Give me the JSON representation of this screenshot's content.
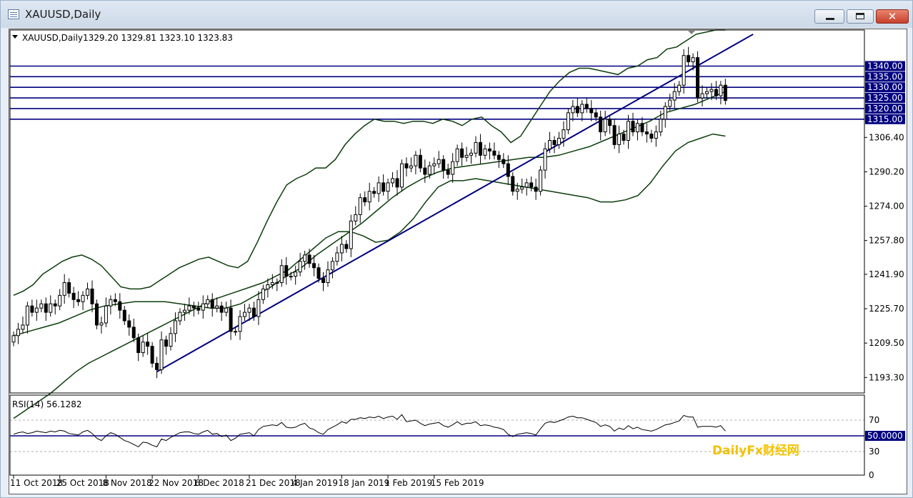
{
  "window": {
    "title": "XAUUSD,Daily",
    "close_glyph": "✕"
  },
  "watermark": "DailyFx财经网",
  "colors": {
    "candle": "#000000",
    "band": "#0b3d0b",
    "level": "#000080",
    "trend": "#000080",
    "rsi": "#000000",
    "price_tag_bg": "#000080"
  },
  "chart_data": {
    "type": "candlestick",
    "symbol_header": "XAUUSD,Daily",
    "ohlc_header": "1329.20 1329.81 1323.10 1323.83",
    "ylim": [
      1186,
      1357
    ],
    "y_ticks": [
      "1306.40",
      "1290.20",
      "1274.00",
      "1257.80",
      "1241.90",
      "1225.70",
      "1209.50",
      "1193.30"
    ],
    "y_tick_values": [
      1306.4,
      1290.2,
      1274.0,
      1257.8,
      1241.9,
      1225.7,
      1209.5,
      1193.3
    ],
    "x_ticks": [
      "11 Oct 2018",
      "25 Oct 2018",
      "8 Nov 2018",
      "22 Nov 2018",
      "6 Dec 2018",
      "21 Dec 2018",
      "4 Jan 2019",
      "18 Jan 2019",
      "1 Feb 2019",
      "15 Feb 2019"
    ],
    "x_tick_index": [
      0,
      10,
      20,
      30,
      40,
      51,
      61,
      71,
      81,
      91
    ],
    "close": [
      1213,
      1216,
      1218,
      1227,
      1224,
      1226,
      1228,
      1224,
      1228,
      1227,
      1232,
      1238,
      1233,
      1230,
      1229,
      1232,
      1235,
      1228,
      1218,
      1219,
      1227,
      1230,
      1229,
      1225,
      1220,
      1217,
      1212,
      1205,
      1210,
      1208,
      1200,
      1197,
      1211,
      1208,
      1214,
      1220,
      1224,
      1225,
      1227,
      1226,
      1225,
      1228,
      1230,
      1226,
      1227,
      1224,
      1226,
      1215,
      1215,
      1222,
      1224,
      1226,
      1222,
      1230,
      1235,
      1237,
      1238,
      1238,
      1246,
      1241,
      1241,
      1243,
      1248,
      1251,
      1247,
      1245,
      1240,
      1238,
      1244,
      1248,
      1252,
      1256,
      1254,
      1267,
      1270,
      1278,
      1276,
      1281,
      1280,
      1285,
      1281,
      1285,
      1287,
      1283,
      1294,
      1292,
      1293,
      1298,
      1292,
      1289,
      1293,
      1294,
      1296,
      1291,
      1289,
      1295,
      1301,
      1297,
      1298,
      1299,
      1304,
      1298,
      1301,
      1300,
      1298,
      1296,
      1294,
      1288,
      1281,
      1282,
      1283,
      1285,
      1283,
      1281,
      1291,
      1301,
      1305,
      1303,
      1306,
      1310,
      1318,
      1321,
      1318,
      1322,
      1320,
      1318,
      1316,
      1309,
      1315,
      1312,
      1303,
      1308,
      1305,
      1314,
      1309,
      1313,
      1309,
      1308,
      1306,
      1309,
      1315,
      1321,
      1324,
      1328,
      1331,
      1345,
      1342,
      1344,
      1325,
      1327,
      1328,
      1329,
      1326,
      1331,
      1323.83
    ],
    "bb_upper": [
      1232,
      1234,
      1237,
      1242,
      1245,
      1248,
      1250,
      1251,
      1249,
      1246,
      1241,
      1236,
      1235,
      1235,
      1236,
      1239,
      1242,
      1245,
      1247,
      1249,
      1250,
      1248,
      1246,
      1245,
      1248,
      1257,
      1267,
      1276,
      1284,
      1287,
      1289,
      1292,
      1292,
      1296,
      1303,
      1308,
      1312,
      1315,
      1314,
      1314,
      1313,
      1314,
      1314,
      1313,
      1315,
      1314,
      1312,
      1315,
      1316,
      1312,
      1309,
      1304,
      1307,
      1314,
      1321,
      1328,
      1333,
      1337,
      1339,
      1339,
      1338,
      1337,
      1336,
      1339,
      1340,
      1343,
      1344,
      1348,
      1349,
      1352,
      1355,
      1356,
      1357,
      1357
    ],
    "bb_mid": [
      1213,
      1215,
      1217,
      1219,
      1222,
      1225,
      1227,
      1228,
      1229,
      1229,
      1229,
      1228,
      1227,
      1226,
      1226,
      1228,
      1232,
      1236,
      1241,
      1245,
      1251,
      1256,
      1261,
      1266,
      1272,
      1278,
      1283,
      1287,
      1290,
      1292,
      1293,
      1294,
      1295,
      1296,
      1297,
      1297,
      1298,
      1300,
      1302,
      1305,
      1308,
      1311,
      1314,
      1318,
      1320,
      1322,
      1325,
      1328
    ],
    "bb_lower": [
      1174,
      1178,
      1182,
      1186,
      1191,
      1196,
      1200,
      1203,
      1206,
      1209,
      1212,
      1215,
      1218,
      1221,
      1224,
      1227,
      1230,
      1232,
      1234,
      1236,
      1238,
      1241,
      1244,
      1249,
      1254,
      1259,
      1262,
      1262,
      1260,
      1257,
      1258,
      1262,
      1268,
      1276,
      1283,
      1286,
      1286,
      1287,
      1286,
      1285,
      1284,
      1283,
      1282,
      1281,
      1280,
      1279,
      1278,
      1276,
      1276,
      1277,
      1279,
      1285,
      1293,
      1300,
      1304,
      1306,
      1308,
      1307
    ],
    "levels": [
      1340.0,
      1335.0,
      1330.0,
      1325.0,
      1320.0,
      1315.0
    ],
    "level_labels": [
      "1340.00",
      "1335.00",
      "1330.00",
      "1325.00",
      "1320.00",
      "1315.00"
    ],
    "trendline": {
      "start_index": 31,
      "start_price": 1196,
      "end_index": 160,
      "end_price": 1355
    },
    "rsi": {
      "label": "RSI(14) 56.1282",
      "levels": [
        70,
        50,
        30
      ],
      "level_labels": [
        "70",
        "30",
        "0"
      ],
      "highlight_level_label": "50.0000",
      "values": [
        52,
        54,
        55,
        53,
        54,
        56,
        55,
        54,
        56,
        55,
        57,
        56,
        53,
        52,
        51,
        55,
        57,
        53,
        47,
        44,
        50,
        54,
        52,
        48,
        44,
        42,
        39,
        36,
        42,
        41,
        38,
        36,
        46,
        44,
        48,
        51,
        54,
        55,
        55,
        53,
        52,
        55,
        57,
        52,
        53,
        49,
        51,
        44,
        47,
        52,
        53,
        54,
        50,
        58,
        62,
        63,
        64,
        63,
        67,
        61,
        60,
        61,
        64,
        66,
        60,
        58,
        54,
        52,
        58,
        61,
        64,
        68,
        66,
        71,
        71,
        73,
        72,
        74,
        73,
        75,
        72,
        74,
        75,
        71,
        77,
        68,
        69,
        70,
        66,
        63,
        65,
        66,
        67,
        63,
        61,
        64,
        68,
        64,
        66,
        66,
        68,
        63,
        64,
        63,
        61,
        60,
        58,
        52,
        49,
        52,
        53,
        54,
        53,
        51,
        59,
        66,
        68,
        67,
        69,
        71,
        74,
        75,
        73,
        73,
        71,
        69,
        67,
        62,
        64,
        62,
        56,
        60,
        58,
        63,
        59,
        61,
        58,
        57,
        56,
        58,
        61,
        64,
        65,
        67,
        69,
        76,
        74,
        74,
        61,
        62,
        62,
        62,
        61,
        63,
        56.1
      ]
    }
  }
}
